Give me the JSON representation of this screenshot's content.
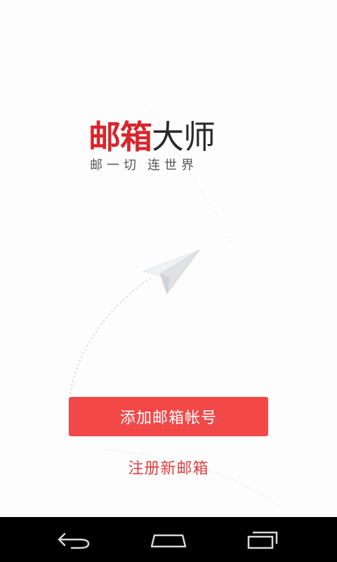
{
  "app": {
    "logo_primary": "邮箱",
    "logo_secondary": "大师",
    "slogan_part1": "邮一切",
    "slogan_part2": "连世界"
  },
  "actions": {
    "add_account_label": "添加邮箱帐号",
    "register_label": "注册新邮箱"
  },
  "navbar": {
    "buttons": [
      "back-icon",
      "home-icon",
      "recents-icon"
    ]
  },
  "colors": {
    "accent": "#f24848",
    "link": "#e23c3c",
    "logo_red": "#d9252c",
    "navbar_bg": "#000000"
  }
}
